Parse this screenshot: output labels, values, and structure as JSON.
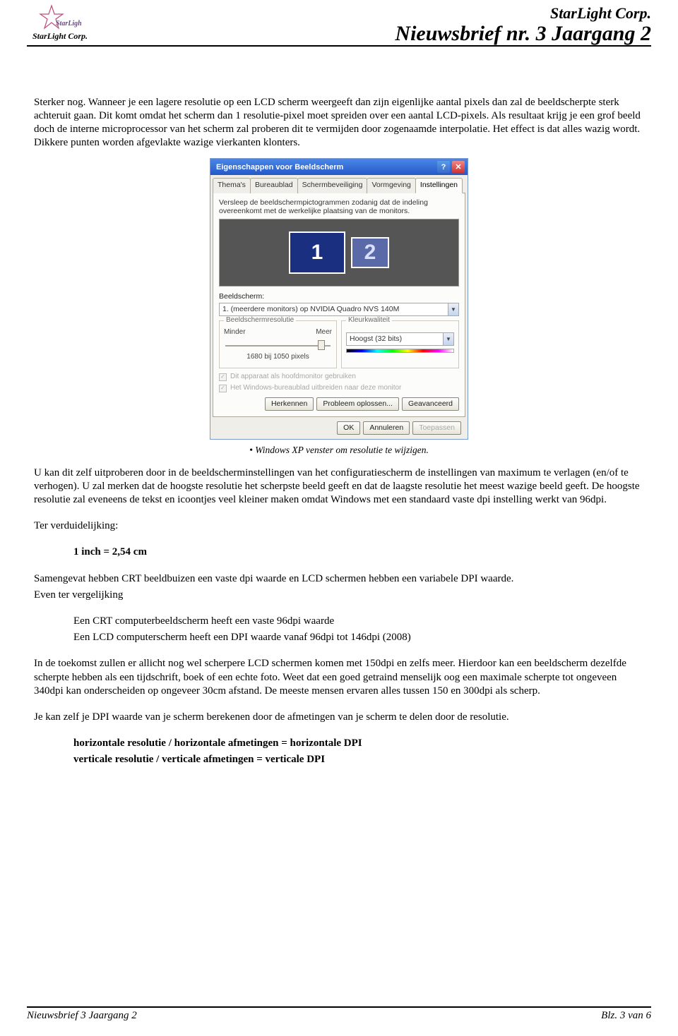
{
  "header": {
    "logo_script": "StarLight",
    "logo_sub": "StarLight Corp.",
    "company": "StarLight Corp.",
    "newsletter": "Nieuwsbrief nr. 3 Jaargang 2"
  },
  "para1": "Sterker nog. Wanneer je een lagere resolutie op een LCD scherm weergeeft dan zijn eigenlijke aantal pixels dan zal de beeldscherpte sterk achteruit gaan. Dit komt omdat het scherm dan 1 resolutie-pixel moet spreiden over een aantal LCD-pixels. Als resultaat krijg je een grof beeld doch de interne microprocessor van het scherm zal proberen dit te vermijden door zogenaamde interpolatie. Het effect is dat alles wazig wordt. Dikkere punten worden afgevlakte wazige vierkanten klonters.",
  "dialog": {
    "title": "Eigenschappen voor Beeldscherm",
    "tabs": [
      "Thema's",
      "Bureaublad",
      "Schermbeveiliging",
      "Vormgeving",
      "Instellingen"
    ],
    "active_tab": "Instellingen",
    "instructions": "Versleep de beeldschermpictogrammen zodanig dat de indeling overeenkomt met de werkelijke plaatsing van de monitors.",
    "mon1": "1",
    "mon2": "2",
    "display_label": "Beeldscherm:",
    "display_value": "1. (meerdere monitors) op NVIDIA Quadro NVS 140M",
    "res_group": "Beeldschermresolutie",
    "res_min": "Minder",
    "res_max": "Meer",
    "res_value": "1680 bij 1050 pixels",
    "color_group": "Kleurkwaliteit",
    "color_value": "Hoogst (32 bits)",
    "chk1": "Dit apparaat als hoofdmonitor gebruiken",
    "chk2": "Het Windows-bureaublad uitbreiden naar deze monitor",
    "btn_identify": "Herkennen",
    "btn_troubleshoot": "Probleem oplossen...",
    "btn_advanced": "Geavanceerd",
    "btn_ok": "OK",
    "btn_cancel": "Annuleren",
    "btn_apply": "Toepassen"
  },
  "caption": "• Windows XP venster om resolutie te wijzigen.",
  "para2": "U kan dit zelf uitproberen door in de beeldscherminstellingen van het configuratiescherm de instellingen van maximum te verlagen (en/of te verhogen). U zal merken dat de hoogste resolutie het scherpste beeld geeft en dat de laagste resolutie het meest wazige beeld geeft. De hoogste resolutie zal eveneens de tekst en icoontjes veel kleiner maken omdat Windows met een standaard vaste dpi instelling werkt van 96dpi.",
  "clarify": "Ter verduidelijking:",
  "inch_cm": "1 inch = 2,54 cm",
  "para3a": "Samengevat hebben CRT beeldbuizen een vaste dpi waarde en LCD schermen hebben een variabele DPI waarde.",
  "para3b": "Even ter vergelijking",
  "bullet1": "Een CRT computerbeeldscherm heeft een vaste 96dpi waarde",
  "bullet2": "Een LCD computerscherm heeft een DPI waarde vanaf 96dpi tot 146dpi (2008)",
  "para4": "In de toekomst zullen er allicht nog wel scherpere LCD schermen komen met 150dpi en zelfs meer. Hierdoor kan een beeldscherm dezelfde scherpte hebben als een tijdschrift, boek of een echte foto. Weet dat een goed getraind menselijk oog een maximale scherpte tot ongeveen 340dpi kan onderscheiden op ongeveer 30cm afstand. De meeste mensen  ervaren alles tussen 150 en 300dpi als scherp.",
  "para5": "Je kan zelf je DPI waarde van je scherm berekenen door de afmetingen van je scherm te delen door de resolutie.",
  "formula1": "horizontale resolutie / horizontale afmetingen = horizontale DPI",
  "formula2": "verticale resolutie / verticale afmetingen = verticale DPI",
  "footer": {
    "left": "Nieuwsbrief 3 Jaargang 2",
    "right": "Blz. 3 van 6"
  }
}
